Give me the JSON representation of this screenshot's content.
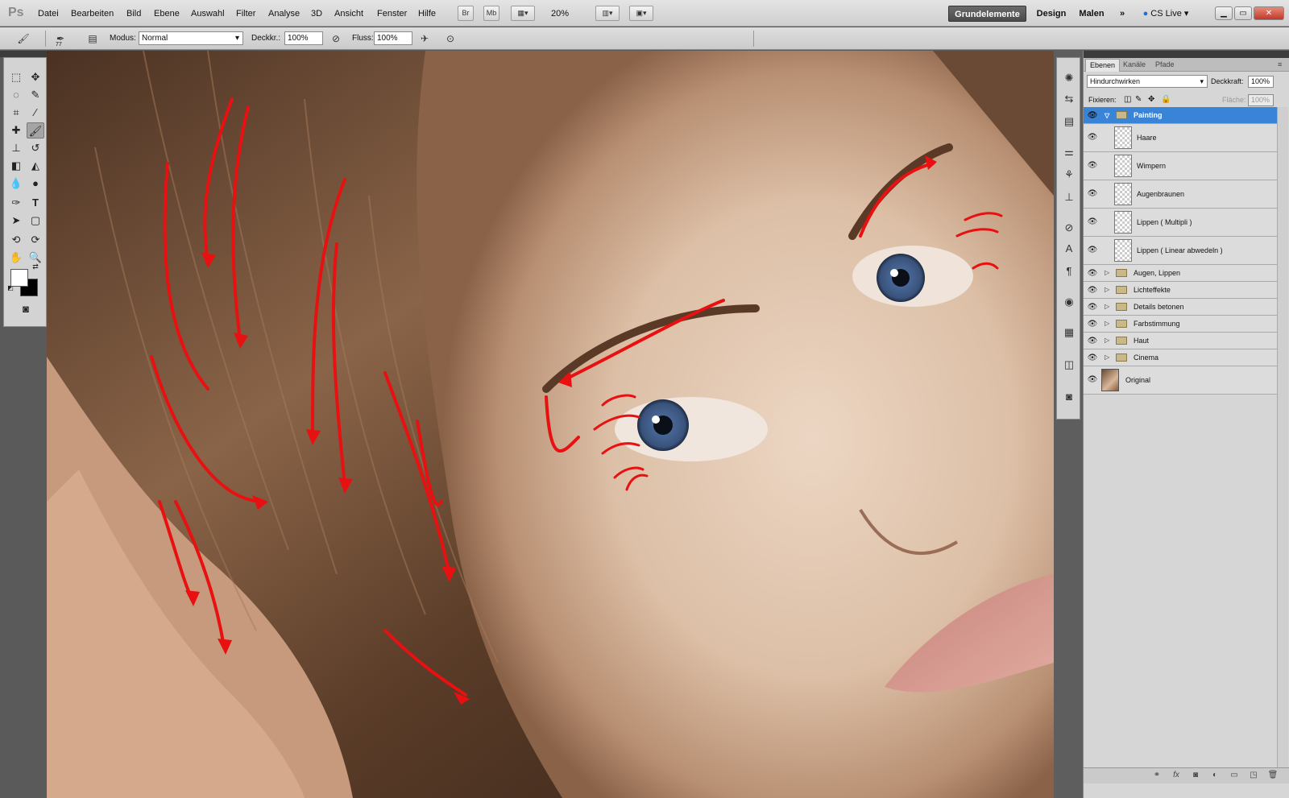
{
  "app": {
    "logo": "Ps",
    "menu": [
      "Datei",
      "Bearbeiten",
      "Bild",
      "Ebene",
      "Auswahl",
      "Filter",
      "Analyse",
      "3D",
      "Ansicht",
      "Fenster",
      "Hilfe"
    ],
    "bridge_label": "Br",
    "minibridge_label": "Mb",
    "zoom": "20%",
    "workspaces": [
      "Grundelemente",
      "Design",
      "Malen"
    ],
    "more": "»",
    "cs_live": "CS Live"
  },
  "options": {
    "modus_label": "Modus:",
    "modus_value": "Normal",
    "deckkraft_label": "Deckkr.:",
    "deckkraft_value": "100%",
    "fluss_label": "Fluss:",
    "fluss_value": "100%",
    "brush_size": "77"
  },
  "colors": {
    "foreground": "#ffffff",
    "background": "#000000",
    "selection": "#3a84d8",
    "arrow": "#e81010"
  },
  "layers_panel": {
    "tabs": [
      "Ebenen",
      "Kanäle",
      "Pfade"
    ],
    "blend_mode": "Hindurchwirken",
    "deckkraft_label": "Deckkraft:",
    "deckkraft_value": "100%",
    "fixieren_label": "Fixieren:",
    "flaeche_label": "Fläche:",
    "flaeche_value": "100%",
    "group_open": "Painting",
    "sub_layers": [
      "Haare",
      "Wimpern",
      "Augenbraunen",
      "Lippen ( Multipli )",
      "Lippen ( Linear abwedeln )"
    ],
    "groups": [
      "Augen, Lippen",
      "Lichteffekte",
      "Details betonen",
      "Farbstimmung",
      "Haut",
      "Cinema"
    ],
    "original": "Original"
  }
}
